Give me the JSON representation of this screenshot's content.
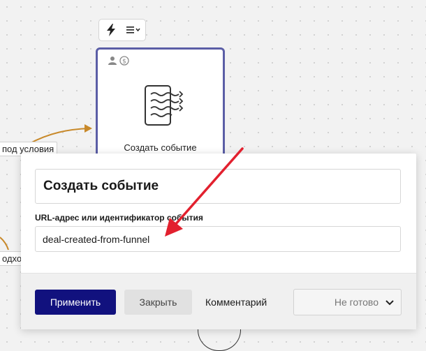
{
  "canvas": {
    "node": {
      "title": "Создать событие",
      "icons": [
        "user-icon",
        "dollar-icon",
        "event-waves-icon"
      ]
    },
    "toolbar": {
      "icons": [
        "lightning-icon",
        "list-dropdown-icon"
      ]
    },
    "edge_labels": {
      "condition": "под условия",
      "revenue": "одход"
    }
  },
  "dialog": {
    "title": "Создать событие",
    "field_label": "URL-адрес или идентификатор события",
    "field_value": "deal-created-from-funnel",
    "buttons": {
      "apply": "Применить",
      "close": "Закрыть",
      "comment": "Комментарий"
    },
    "status": {
      "value": "Не готово"
    }
  },
  "colors": {
    "primary": "#11117e",
    "node_border": "#5b5ea6",
    "annotation_arrow": "#e2202e",
    "edge": "#c8892a"
  }
}
